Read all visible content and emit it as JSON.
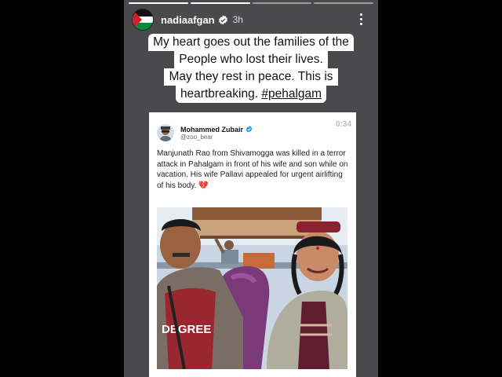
{
  "story": {
    "username": "nadiaafgan",
    "time": "3h",
    "progress_segments": 4,
    "active_segment": 1,
    "caption_lines": [
      "My heart goes out the families of the",
      "People who lost their lives.",
      "May they rest in peace. This is",
      "heartbreaking."
    ],
    "hashtag": "#pehalgam",
    "icons": {
      "avatar": "palestine-flag-avatar",
      "verified": "verified-badge-icon",
      "more": "more-vertical-icon"
    }
  },
  "tweet": {
    "author_name": "Mohammed Zubair",
    "author_handle": "@zoo_bear",
    "video_time": "0:34",
    "text": "Manjunath Rao from Shivamogga was killed in a terror attack in Pahalgam in front of his wife and son while on vacation. His wife Pallavi appealed for urgent airlifting of his body.",
    "emoji": "💔",
    "shirt_text": "DEGREE",
    "colors": {
      "verified": "#1d9bf0",
      "heart": "#e0264b"
    }
  }
}
